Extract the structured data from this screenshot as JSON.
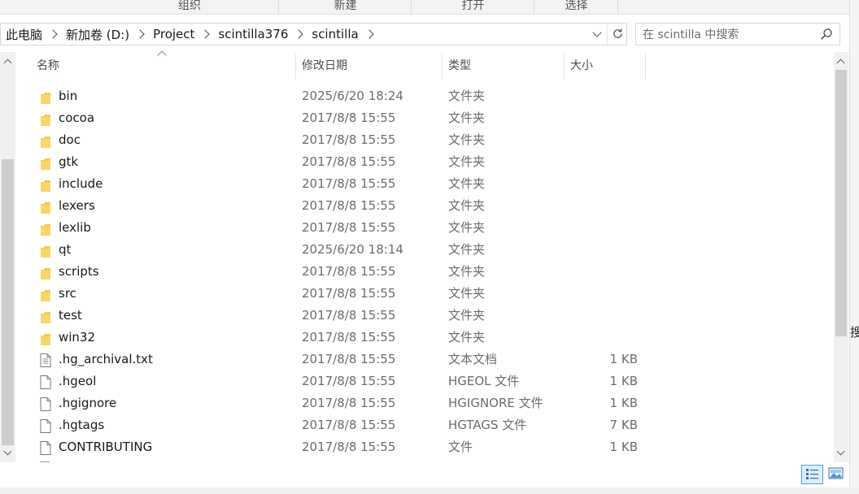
{
  "ribbon": {
    "groups": [
      "组织",
      "新建",
      "打开",
      "选择"
    ]
  },
  "address": {
    "crumbs": [
      "此电脑",
      "新加卷 (D:)",
      "Project",
      "scintilla376",
      "scintilla"
    ]
  },
  "search": {
    "placeholder": "在 scintilla 中搜索"
  },
  "columns": {
    "name": "名称",
    "date": "修改日期",
    "type": "类型",
    "size": "大小"
  },
  "files": [
    {
      "name": "bin",
      "date": "2025/6/20 18:24",
      "type": "文件夹",
      "size": "",
      "icon": "folder-icon"
    },
    {
      "name": "cocoa",
      "date": "2017/8/8 15:55",
      "type": "文件夹",
      "size": "",
      "icon": "folder-icon"
    },
    {
      "name": "doc",
      "date": "2017/8/8 15:55",
      "type": "文件夹",
      "size": "",
      "icon": "folder-icon"
    },
    {
      "name": "gtk",
      "date": "2017/8/8 15:55",
      "type": "文件夹",
      "size": "",
      "icon": "folder-icon"
    },
    {
      "name": "include",
      "date": "2017/8/8 15:55",
      "type": "文件夹",
      "size": "",
      "icon": "folder-icon"
    },
    {
      "name": "lexers",
      "date": "2017/8/8 15:55",
      "type": "文件夹",
      "size": "",
      "icon": "folder-icon"
    },
    {
      "name": "lexlib",
      "date": "2017/8/8 15:55",
      "type": "文件夹",
      "size": "",
      "icon": "folder-icon"
    },
    {
      "name": "qt",
      "date": "2025/6/20 18:14",
      "type": "文件夹",
      "size": "",
      "icon": "folder-icon"
    },
    {
      "name": "scripts",
      "date": "2017/8/8 15:55",
      "type": "文件夹",
      "size": "",
      "icon": "folder-icon"
    },
    {
      "name": "src",
      "date": "2017/8/8 15:55",
      "type": "文件夹",
      "size": "",
      "icon": "folder-icon"
    },
    {
      "name": "test",
      "date": "2017/8/8 15:55",
      "type": "文件夹",
      "size": "",
      "icon": "folder-icon"
    },
    {
      "name": "win32",
      "date": "2017/8/8 15:55",
      "type": "文件夹",
      "size": "",
      "icon": "folder-icon"
    },
    {
      "name": ".hg_archival.txt",
      "date": "2017/8/8 15:55",
      "type": "文本文档",
      "size": "1 KB",
      "icon": "text-file-icon"
    },
    {
      "name": ".hgeol",
      "date": "2017/8/8 15:55",
      "type": "HGEOL 文件",
      "size": "1 KB",
      "icon": "file-icon"
    },
    {
      "name": ".hgignore",
      "date": "2017/8/8 15:55",
      "type": "HGIGNORE 文件",
      "size": "1 KB",
      "icon": "file-icon"
    },
    {
      "name": ".hgtags",
      "date": "2017/8/8 15:55",
      "type": "HGTAGS 文件",
      "size": "7 KB",
      "icon": "file-icon"
    },
    {
      "name": "CONTRIBUTING",
      "date": "2017/8/8 15:55",
      "type": "文件",
      "size": "1 KB",
      "icon": "file-icon"
    }
  ],
  "edge_text": "搜",
  "colors": {
    "folder": "#f7c948",
    "accent": "#5aa0e0",
    "meta_text": "#6d6d6d"
  }
}
